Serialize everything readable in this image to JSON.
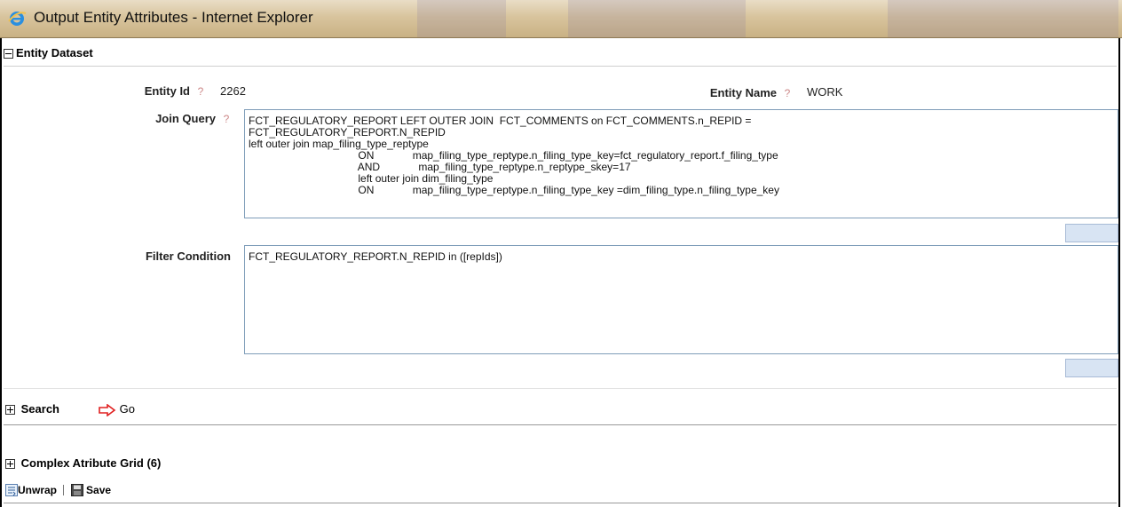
{
  "window": {
    "title": "Output Entity Attributes - Internet Explorer"
  },
  "entity_dataset": {
    "header": "Entity Dataset",
    "entity_id_label": "Entity Id",
    "entity_id_value": "2262",
    "entity_name_label": "Entity Name",
    "entity_name_value": "WORK",
    "help_glyph": "?",
    "join_query_label": "Join Query",
    "join_query_value": "FCT_REGULATORY_REPORT LEFT OUTER JOIN  FCT_COMMENTS on FCT_COMMENTS.n_REPID =\nFCT_REGULATORY_REPORT.N_REPID\nleft outer join map_filing_type_reptype\n                                     ON             map_filing_type_reptype.n_filing_type_key=fct_regulatory_report.f_filing_type\n                                     AND             map_filing_type_reptype.n_reptype_skey=17\n                                     left outer join dim_filing_type\n                                     ON             map_filing_type_reptype.n_filing_type_key =dim_filing_type.n_filing_type_key",
    "filter_condition_label": "Filter Condition",
    "filter_condition_value": "FCT_REGULATORY_REPORT.N_REPID in ([repIds])"
  },
  "search": {
    "label": "Search",
    "go_label": "Go"
  },
  "grid": {
    "title": "Complex Atribute Grid",
    "count": "(6)",
    "unwrap_label": "Unwrap",
    "save_label": "Save"
  },
  "colors": {
    "accent_border": "#7f9db9",
    "go_arrow": "#e02020",
    "button_fill": "#d8e4f3"
  }
}
